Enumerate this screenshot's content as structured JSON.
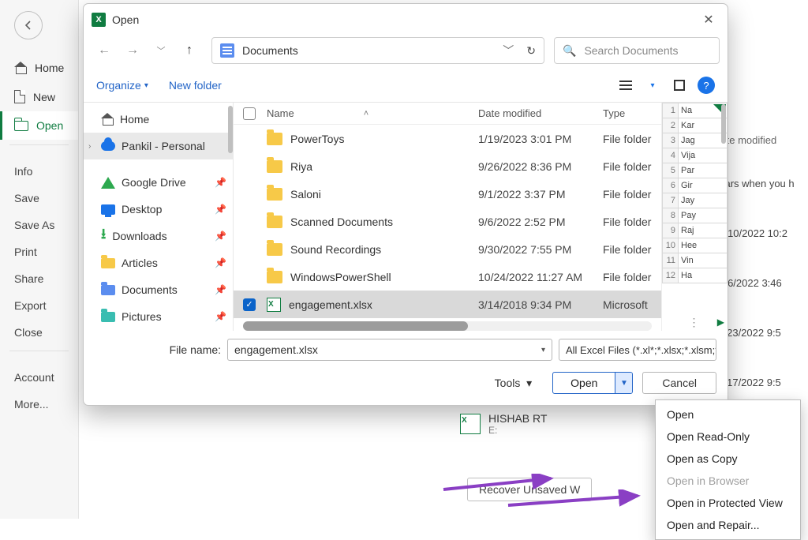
{
  "backstage": {
    "items": [
      "Home",
      "New",
      "Open"
    ],
    "active": "Open",
    "secondary": [
      "Info",
      "Save",
      "Save As",
      "Print",
      "Share",
      "Export",
      "Close"
    ],
    "footer": [
      "Account",
      "More..."
    ],
    "recent_header": "Date modified",
    "recent_note": "pears when you h",
    "recent_dates": [
      "12/10/2022 10:2",
      "12/6/2022 3:46",
      "11/23/2022 9:5",
      "11/17/2022 9:5"
    ]
  },
  "dialog": {
    "title": "Open",
    "breadcrumb": "Documents",
    "search_placeholder": "Search Documents",
    "organize": "Organize",
    "new_folder": "New folder",
    "tree": {
      "home": "Home",
      "personal": "Pankil - Personal",
      "quick": [
        {
          "label": "Google Drive",
          "icon": "gdrive"
        },
        {
          "label": "Desktop",
          "icon": "desktop"
        },
        {
          "label": "Downloads",
          "icon": "download"
        },
        {
          "label": "Articles",
          "icon": "folder"
        },
        {
          "label": "Documents",
          "icon": "docfolder"
        },
        {
          "label": "Pictures",
          "icon": "picfolder"
        }
      ]
    },
    "cols": {
      "name": "Name",
      "date": "Date modified",
      "type": "Type"
    },
    "rows": [
      {
        "name": "PowerToys",
        "date": "1/19/2023 3:01 PM",
        "type": "File folder",
        "kind": "folder"
      },
      {
        "name": "Riya",
        "date": "9/26/2022 8:36 PM",
        "type": "File folder",
        "kind": "folder"
      },
      {
        "name": "Saloni",
        "date": "9/1/2022 3:37 PM",
        "type": "File folder",
        "kind": "folder"
      },
      {
        "name": "Scanned Documents",
        "date": "9/6/2022 2:52 PM",
        "type": "File folder",
        "kind": "folder"
      },
      {
        "name": "Sound Recordings",
        "date": "9/30/2022 7:55 PM",
        "type": "File folder",
        "kind": "folder"
      },
      {
        "name": "WindowsPowerShell",
        "date": "10/24/2022 11:27 AM",
        "type": "File folder",
        "kind": "folder"
      },
      {
        "name": "engagement.xlsx",
        "date": "3/14/2018 9:34 PM",
        "type": "Microsoft",
        "kind": "xlsx",
        "selected": true
      }
    ],
    "preview_rows": [
      "Na",
      "Kar",
      "Jag",
      "Vija",
      "Par",
      "Gir",
      "Jay",
      "Pay",
      "Raj",
      "Hee",
      "Vin",
      "Ha"
    ],
    "filename_label": "File name:",
    "filename_value": "engagement.xlsx",
    "filter": "All Excel Files (*.xl*;*.xlsx;*.xlsm;",
    "tools": "Tools",
    "open_btn": "Open",
    "cancel_btn": "Cancel"
  },
  "open_menu": {
    "items": [
      {
        "label": "Open",
        "enabled": true
      },
      {
        "label": "Open Read-Only",
        "enabled": true
      },
      {
        "label": "Open as Copy",
        "enabled": true
      },
      {
        "label": "Open in Browser",
        "enabled": false
      },
      {
        "label": "Open in Protected View",
        "enabled": true
      },
      {
        "label": "Open and Repair...",
        "enabled": true
      }
    ]
  },
  "recover_btn": "Recover Unsaved W",
  "recent_peek": {
    "name": "HISHAB RT",
    "sub": "E:"
  }
}
